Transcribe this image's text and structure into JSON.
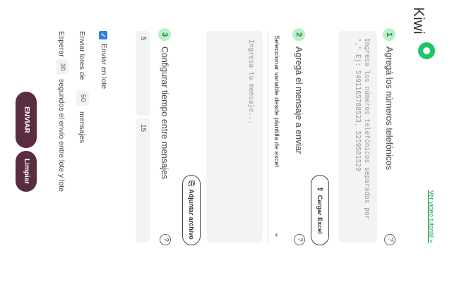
{
  "header": {
    "logo_text": "Kiwi",
    "tutorial_link": "Ver video tutorial »"
  },
  "step1": {
    "number": "1",
    "title": "Agregá los números telefónicos",
    "phones_placeholder": "Ingresa los números telefónicos separados por \",\" Ej: 5491165788523, 5259581529",
    "upload_label": "Cargar Excel",
    "help": "?"
  },
  "step2": {
    "number": "2",
    "title": "Agregá el mensaje a enviar",
    "help": "?",
    "variable_select": "Seleccionar variable desde plantilla de excel",
    "message_placeholder": "Ingresa tu mensaje...",
    "attach_label": "Adjuntar archivo"
  },
  "step3": {
    "number": "3",
    "title": "Configurar tiempo entre mensajes",
    "help": "?",
    "min_seconds": "5",
    "max_seconds": "15",
    "batch_checkbox_label": "Enviar en lote",
    "batch_prefix": "Enviar lotes de",
    "batch_size": "50",
    "batch_suffix": "mensajes",
    "wait_prefix": "Esperar",
    "wait_seconds": "30",
    "wait_suffix": "segundos el envío entre lote y lote"
  },
  "actions": {
    "send_label": "ENVIAR",
    "clear_label": "Limpiar"
  },
  "colors": {
    "accent_green": "#1fc46a",
    "step_circle_bg": "#b8f0c8",
    "dark_button": "#5a2c41",
    "checkbox_blue": "#2d7fe0"
  }
}
